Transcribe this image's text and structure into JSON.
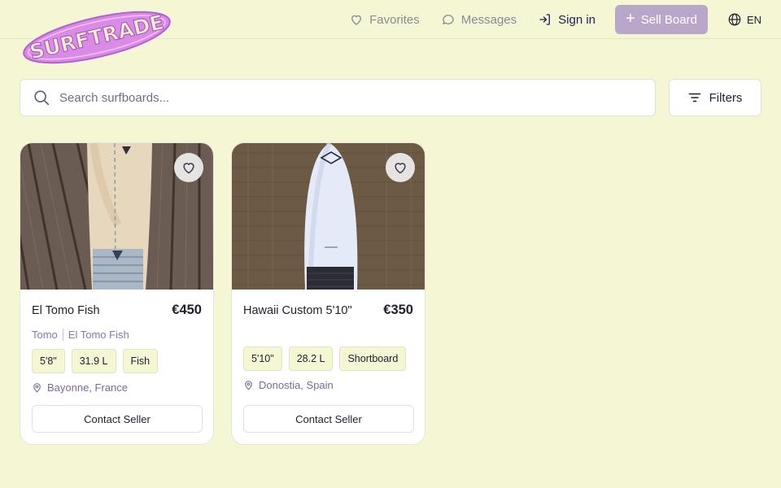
{
  "header": {
    "logo_text": "SURFTRADE",
    "nav": {
      "favorites": "Favorites",
      "messages": "Messages",
      "sign_in": "Sign in",
      "sell_board": "Sell Board",
      "language": "EN"
    }
  },
  "search": {
    "placeholder": "Search surfboards...",
    "value": ""
  },
  "filters": {
    "label": "Filters"
  },
  "listings": [
    {
      "title": "El Tomo Fish",
      "price": "€450",
      "brand": "Tomo",
      "model": "El Tomo Fish",
      "tags": [
        "5'8\"",
        "31.9 L",
        "Fish"
      ],
      "location": "Bayonne, France",
      "contact_label": "Contact Seller"
    },
    {
      "title": "Hawaii Custom 5'10\"",
      "price": "€350",
      "tags": [
        "5'10\"",
        "28.2 L",
        "Shortboard"
      ],
      "location": "Donostia, Spain",
      "contact_label": "Contact Seller"
    }
  ],
  "colors": {
    "background": "#f4f6d4",
    "accent": "#b9a7c9",
    "logo_fill": "#d98be6",
    "brand_text": "#8a78a8"
  }
}
